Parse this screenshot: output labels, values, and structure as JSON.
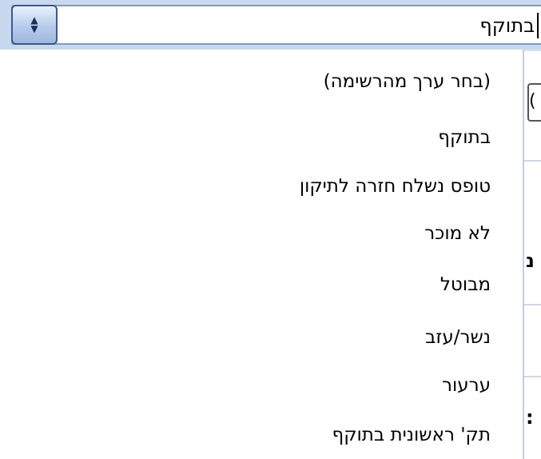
{
  "combo": {
    "value": "בתוקף",
    "spin_icon": "spin-updown-icon"
  },
  "dropdown": {
    "options": [
      "(בחר ערך מהרשימה)",
      "בתוקף",
      "טופס נשלח חזרה לתיקון",
      "לא מוכר",
      "מבוטל",
      "נשר/עזב",
      "ערעור",
      "תק' ראשונית בתוקף"
    ]
  },
  "background": {
    "field_text": "(",
    "glyph_1": "נ",
    "glyph_2": ":"
  }
}
